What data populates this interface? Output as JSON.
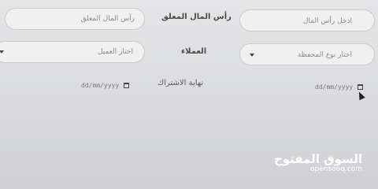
{
  "form": {
    "fields": [
      {
        "label": "رأس المال المعلق",
        "placeholder": "رأس المال المعلق"
      },
      {
        "label": "العملاء",
        "placeholder": "اختار العميل"
      },
      {
        "label": "نهاية الاشتراك",
        "placeholder": "dd/mm/yyyy"
      }
    ],
    "right_column": {
      "capital_placeholder": "ادخل رأس المال",
      "portfolio_placeholder": "اختار نوع المحفظة",
      "date_placeholder": "dd/mm/yyyy"
    }
  },
  "watermark": {
    "arabic": "السوق المفتوح",
    "latin": "opensooq.com"
  }
}
